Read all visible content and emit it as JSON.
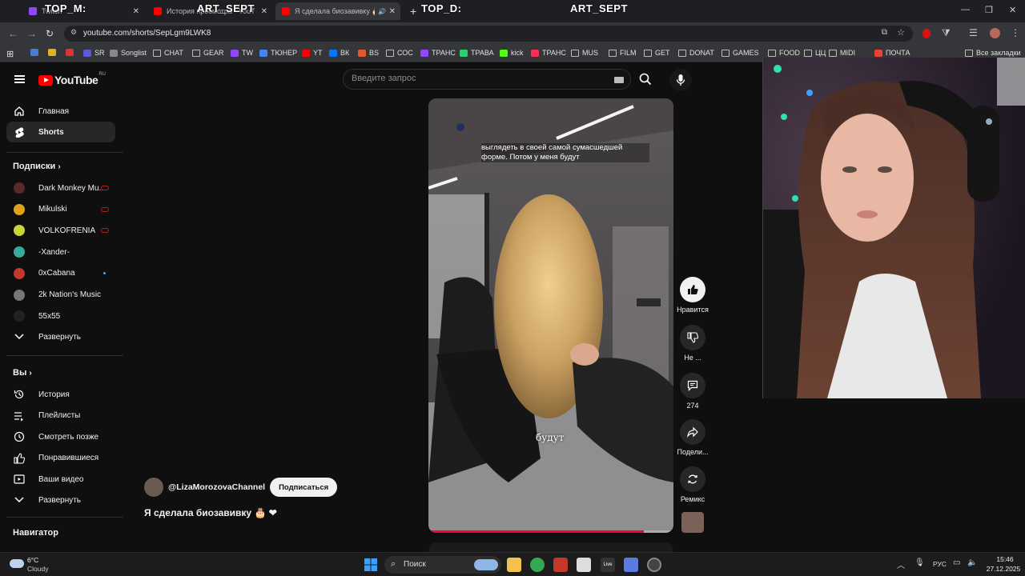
{
  "browser": {
    "tabs": [
      {
        "label": "Twitch",
        "favicon_color": "#9146ff"
      },
      {
        "label": "История просмотра - YouTube",
        "favicon_color": "#ff0000"
      },
      {
        "label": "Я сделала биозавивку 🎂 ❤",
        "favicon_color": "#ff0000"
      }
    ],
    "new_tab": "+",
    "url": "youtube.com/shorts/SepLgm9LWK8",
    "bookmarks": [
      {
        "label": "SR",
        "color": "#5b5bd6"
      },
      {
        "label": "Songlist",
        "color": "#888"
      },
      {
        "label": "CHAT",
        "folder": true
      },
      {
        "label": "GEAR",
        "folder": true
      },
      {
        "label": "TW",
        "color": "#9146ff"
      },
      {
        "label": "ТЮНЕР",
        "color": "#4285f4"
      },
      {
        "label": "YT",
        "color": "#ff0000"
      },
      {
        "label": "ВК",
        "color": "#0077ff"
      },
      {
        "label": "BS",
        "color": "#e05a2b"
      },
      {
        "label": "СОС",
        "folder": true
      },
      {
        "label": "ТРАНС",
        "color": "#9146ff"
      },
      {
        "label": "ТРАВА",
        "color": "#2ecc71"
      },
      {
        "label": "kick",
        "color": "#53fc18"
      },
      {
        "label": "ТРАНС",
        "color": "#ff2d55"
      },
      {
        "label": "MUS",
        "folder": true
      },
      {
        "label": "FILM",
        "folder": true
      },
      {
        "label": "GET",
        "folder": true
      },
      {
        "label": "DONAT",
        "folder": true
      },
      {
        "label": "GAMES",
        "folder": true
      },
      {
        "label": "FOOD",
        "folder": true
      },
      {
        "label": "ЦЦ",
        "folder": true
      },
      {
        "label": "MIDI",
        "folder": true
      },
      {
        "label": "ПОЧТА",
        "color": "#ea4335"
      },
      {
        "label": "Все закладки",
        "folder": true
      }
    ]
  },
  "overlay_labels": {
    "top_m": "TOP_M:",
    "art_sept_1": "ART_SEPT",
    "top_d": "TOP_D:",
    "art_sept_2": "ART_SEPT"
  },
  "youtube": {
    "logo_text": "YouTube",
    "region": "RU",
    "search_placeholder": "Введите запрос",
    "sidebar": {
      "main": [
        {
          "label": "Главная",
          "icon": "home-icon"
        },
        {
          "label": "Shorts",
          "icon": "shorts-icon",
          "active": true
        }
      ],
      "subscriptions_heading": "Подписки",
      "subscriptions": [
        {
          "label": "Dark Monkey Mu...",
          "color": "#5a2a2a",
          "status": "live"
        },
        {
          "label": "Mikulski",
          "color": "#e0a21b",
          "status": "live"
        },
        {
          "label": "VOLKOFRENIA",
          "color": "#c7d43a",
          "status": "live"
        },
        {
          "label": "-Xander-",
          "color": "#3aa89a",
          "status": ""
        },
        {
          "label": "0xCabana",
          "color": "#c0392b",
          "status": "new"
        },
        {
          "label": "2k Nation's Music",
          "color": "#777",
          "status": ""
        },
        {
          "label": "55x55",
          "color": "#222",
          "status": ""
        }
      ],
      "expand_subs": "Развернуть",
      "you_heading": "Вы",
      "you_items": [
        {
          "label": "История",
          "icon": "history-icon"
        },
        {
          "label": "Плейлисты",
          "icon": "playlists-icon"
        },
        {
          "label": "Смотреть позже",
          "icon": "watch-later-icon"
        },
        {
          "label": "Понравившиеся",
          "icon": "liked-icon"
        },
        {
          "label": "Ваши видео",
          "icon": "your-videos-icon"
        }
      ],
      "expand_you": "Развернуть",
      "navigator_heading": "Навигатор"
    },
    "short": {
      "caption_top": "выглядеть в своей самой сумасшедшей форме. Потом у меня будут",
      "caption_bottom": "будут",
      "progress": 0.88,
      "channel": "@LizaMorozovaChannel",
      "subscribe": "Подписаться",
      "title": "Я сделала биозавивку 🎂 ❤",
      "actions": {
        "like": "Нравится",
        "dislike": "Не ...",
        "comments": "274",
        "share": "Подели...",
        "remix": "Ремикс"
      }
    }
  },
  "taskbar": {
    "weather_temp": "6°C",
    "weather_desc": "Cloudy",
    "search_label": "Поиск",
    "lang": "РУС",
    "time": "15:46",
    "date": "27.12.2025"
  }
}
